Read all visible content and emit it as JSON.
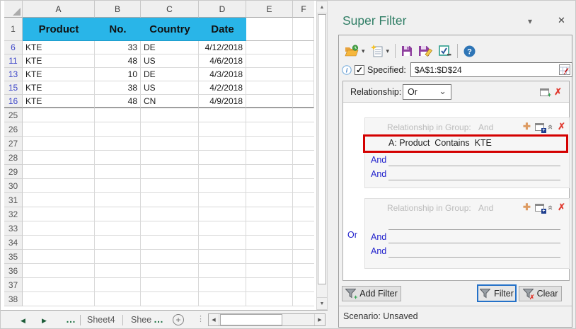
{
  "colors": {
    "header_fill": "#29B5E8",
    "filtered_row_number": "#3C45C8",
    "logic_blue": "#2222CC",
    "pane_title_teal": "#2E7D64",
    "annotation_red": "#D40000",
    "filter_button_border": "#2471C8",
    "sheet_nav_green": "#217346"
  },
  "sheet": {
    "columns": [
      "A",
      "B",
      "C",
      "D",
      "E",
      "F"
    ],
    "header_row": {
      "number": "1",
      "cells": [
        "Product",
        "No.",
        "Country",
        "Date"
      ]
    },
    "data_rows": [
      {
        "number": "6",
        "product": "KTE",
        "no": "33",
        "country": "DE",
        "date": "4/12/2018"
      },
      {
        "number": "11",
        "product": "KTE",
        "no": "48",
        "country": "US",
        "date": "4/6/2018"
      },
      {
        "number": "13",
        "product": "KTE",
        "no": "10",
        "country": "DE",
        "date": "4/3/2018"
      },
      {
        "number": "15",
        "product": "KTE",
        "no": "38",
        "country": "US",
        "date": "4/2/2018"
      },
      {
        "number": "16",
        "product": "KTE",
        "no": "48",
        "country": "CN",
        "date": "4/9/2018"
      }
    ],
    "empty_rows": [
      "25",
      "26",
      "27",
      "28",
      "29",
      "30",
      "31",
      "32",
      "33",
      "34",
      "35",
      "36",
      "37",
      "38"
    ]
  },
  "tabbar": {
    "tabs": [
      {
        "label": "Sheet4"
      },
      {
        "label": "Shee"
      }
    ]
  },
  "panel": {
    "title": "Super Filter",
    "specified": {
      "label": "Specified:",
      "range": "$A$1:$D$24"
    },
    "relationship": {
      "label": "Relationship:",
      "value": "Or"
    },
    "group1": {
      "header_label": "Relationship in Group:",
      "header_value": "And",
      "condition": "A: Product  Contains  KTE",
      "and1": "And",
      "and2": "And"
    },
    "group2": {
      "header_label": "Relationship in Group:",
      "header_value": "And",
      "or_label": "Or",
      "and1": "And",
      "and2": "And"
    },
    "buttons": {
      "add_filter": "Add Filter",
      "filter": "Filter",
      "clear": "Clear"
    },
    "scenario": "Scenario: Unsaved"
  },
  "glyphs": {
    "pane_options": "▾",
    "close": "✕",
    "dropdown_arrow": "▾",
    "combo_chevron": "⌄",
    "check": "✓",
    "info": "i",
    "help": "?",
    "delete": "✗",
    "plus": "✚",
    "collapse": "«",
    "ellipsis": "…",
    "tab_prev": "◀",
    "tab_next": "▶",
    "add_sheet": "+",
    "splitter": "⋮",
    "scroll_up": "▲",
    "scroll_down": "▼",
    "scroll_left": "◀",
    "scroll_right": "▶"
  }
}
